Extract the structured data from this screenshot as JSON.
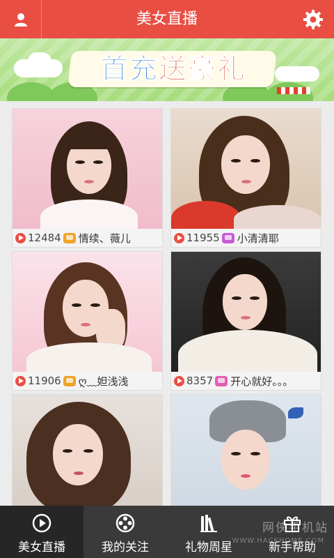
{
  "header": {
    "title": "美女直播",
    "left_icon": "user-icon",
    "right_icon": "gear-icon"
  },
  "banner": {
    "text_part1": "首充",
    "text_part2": "送豪礼"
  },
  "streams": [
    {
      "viewers": "12484",
      "nickname": "情续、薇儿",
      "badge_color": "#f0a326"
    },
    {
      "viewers": "11955",
      "nickname": "小清清耶",
      "badge_color": "#c85ad6"
    },
    {
      "viewers": "11906",
      "nickname": "ღ﹏妲浅浅",
      "badge_color": "#f0a326"
    },
    {
      "viewers": "8357",
      "nickname": "开心就好。。。",
      "badge_color": "#e45fb2"
    },
    {
      "viewers": "",
      "nickname": ""
    },
    {
      "viewers": "",
      "nickname": ""
    }
  ],
  "tabs": [
    {
      "label": "美女直播",
      "icon": "play-circle-icon",
      "active": true
    },
    {
      "label": "我的关注",
      "icon": "film-reel-icon",
      "active": false
    },
    {
      "label": "礼物周星",
      "icon": "books-icon",
      "active": false
    },
    {
      "label": "新手帮助",
      "icon": "gift-icon",
      "active": false
    }
  ],
  "watermark": {
    "text": "网侠手机站",
    "sub": "WWW.HACKHOME.COM"
  },
  "colors": {
    "brand": "#e94e43",
    "tabbar": "#3a3a3a",
    "tab_active": "#262626"
  }
}
